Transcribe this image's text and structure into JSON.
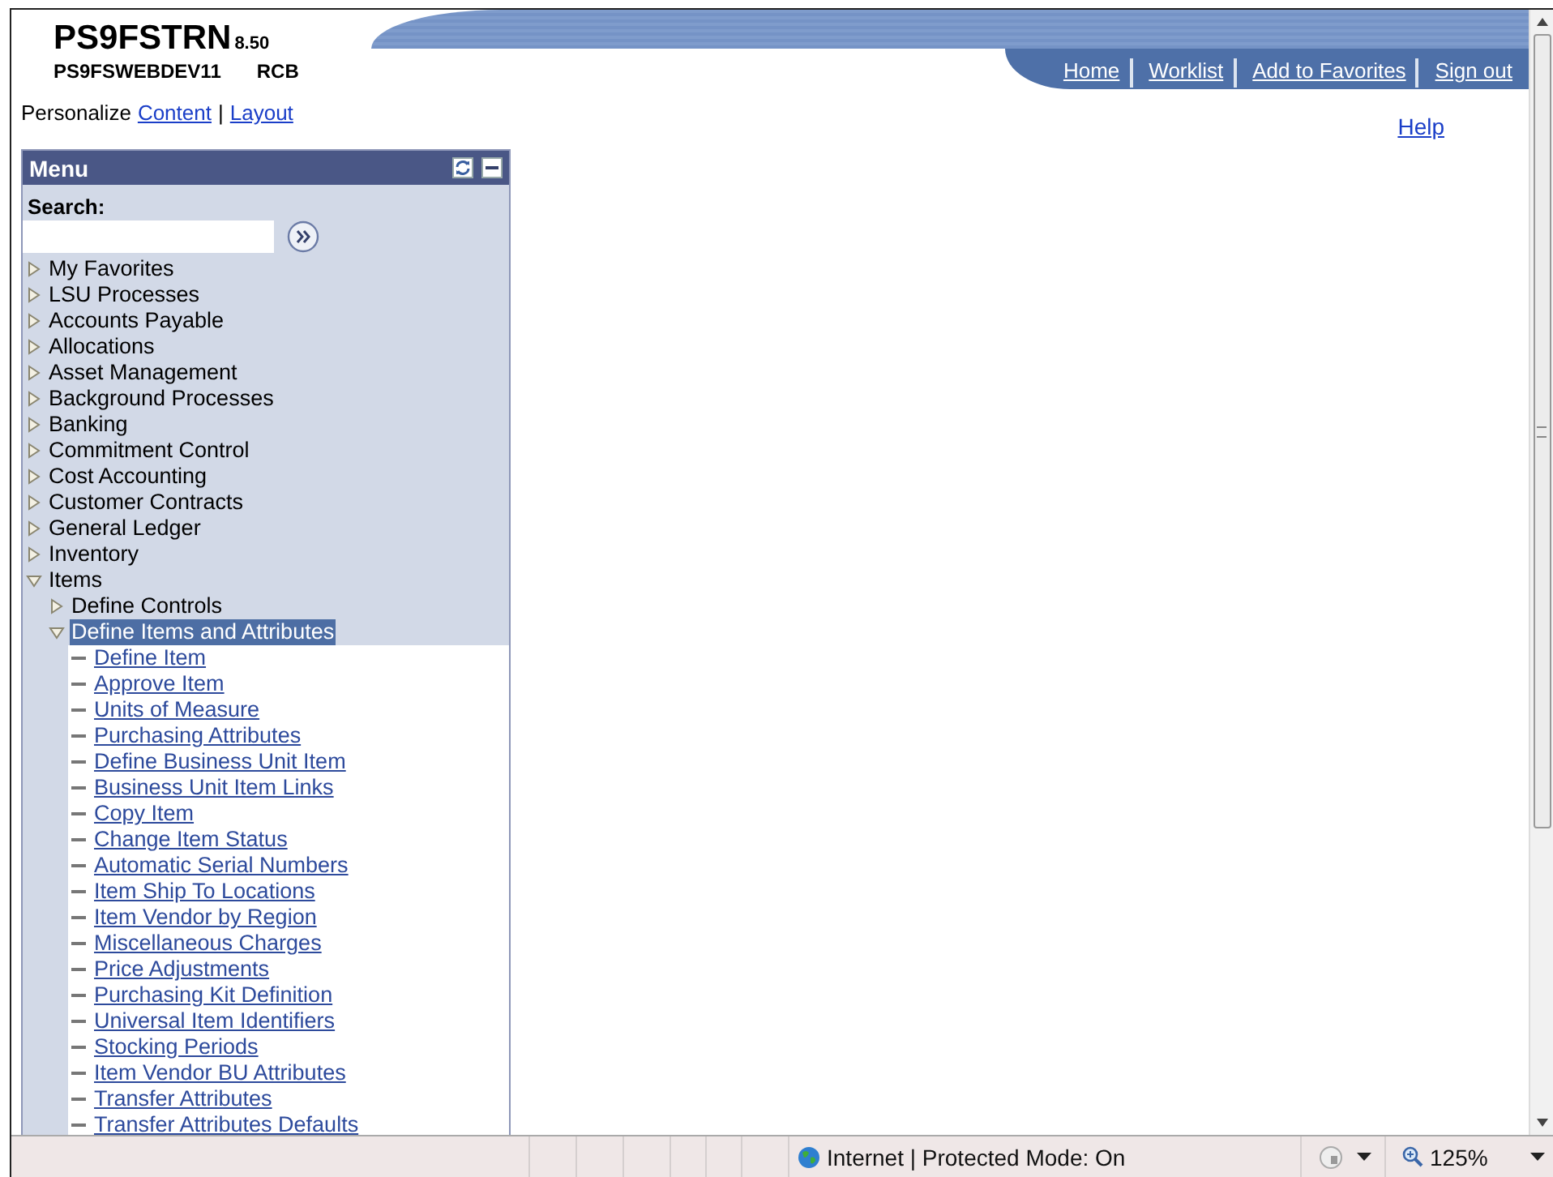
{
  "header": {
    "title": "PS9FSTRN",
    "version": "8.50",
    "server": "PS9FSWEBDEV11",
    "user": "RCB"
  },
  "nav_links": [
    "Home",
    "Worklist",
    "Add to Favorites",
    "Sign out"
  ],
  "help_link": "Help",
  "personalize": {
    "label": "Personalize",
    "links": [
      "Content",
      "Layout"
    ],
    "separator": "|"
  },
  "menu": {
    "title": "Menu",
    "search_label": "Search:",
    "items": [
      {
        "label": "My Favorites",
        "kind": "folder",
        "expanded": false,
        "selected": false
      },
      {
        "label": "LSU Processes",
        "kind": "folder",
        "expanded": false,
        "selected": false
      },
      {
        "label": "Accounts Payable",
        "kind": "folder",
        "expanded": false,
        "selected": false
      },
      {
        "label": "Allocations",
        "kind": "folder",
        "expanded": false,
        "selected": false
      },
      {
        "label": "Asset Management",
        "kind": "folder",
        "expanded": false,
        "selected": false
      },
      {
        "label": "Background Processes",
        "kind": "folder",
        "expanded": false,
        "selected": false
      },
      {
        "label": "Banking",
        "kind": "folder",
        "expanded": false,
        "selected": false
      },
      {
        "label": "Commitment Control",
        "kind": "folder",
        "expanded": false,
        "selected": false
      },
      {
        "label": "Cost Accounting",
        "kind": "folder",
        "expanded": false,
        "selected": false
      },
      {
        "label": "Customer Contracts",
        "kind": "folder",
        "expanded": false,
        "selected": false
      },
      {
        "label": "General Ledger",
        "kind": "folder",
        "expanded": false,
        "selected": false
      },
      {
        "label": "Inventory",
        "kind": "folder",
        "expanded": false,
        "selected": false
      },
      {
        "label": "Items",
        "kind": "folder",
        "expanded": true,
        "selected": false,
        "children": [
          {
            "label": "Define Controls",
            "kind": "folder",
            "expanded": false,
            "selected": false
          },
          {
            "label": "Define Items and Attributes",
            "kind": "folder",
            "expanded": true,
            "selected": true,
            "children": [
              {
                "label": "Define Item",
                "kind": "link"
              },
              {
                "label": "Approve Item",
                "kind": "link"
              },
              {
                "label": "Units of Measure",
                "kind": "link"
              },
              {
                "label": "Purchasing Attributes",
                "kind": "link"
              },
              {
                "label": "Define Business Unit Item",
                "kind": "link"
              },
              {
                "label": "Business Unit Item Links",
                "kind": "link"
              },
              {
                "label": "Copy Item",
                "kind": "link"
              },
              {
                "label": "Change Item Status",
                "kind": "link"
              },
              {
                "label": "Automatic Serial Numbers",
                "kind": "link"
              },
              {
                "label": "Item Ship To Locations",
                "kind": "link"
              },
              {
                "label": "Item Vendor by Region",
                "kind": "link"
              },
              {
                "label": "Miscellaneous Charges",
                "kind": "link"
              },
              {
                "label": "Price Adjustments",
                "kind": "link"
              },
              {
                "label": "Purchasing Kit Definition",
                "kind": "link"
              },
              {
                "label": "Universal Item Identifiers",
                "kind": "link"
              },
              {
                "label": "Stocking Periods",
                "kind": "link"
              },
              {
                "label": "Item Vendor BU Attributes",
                "kind": "link"
              },
              {
                "label": "Transfer Attributes",
                "kind": "link"
              },
              {
                "label": "Transfer Attributes Defaults",
                "kind": "link"
              }
            ]
          }
        ]
      }
    ]
  },
  "status_bar": {
    "zone": "Internet | Protected Mode: On",
    "zoom": "125%"
  }
}
